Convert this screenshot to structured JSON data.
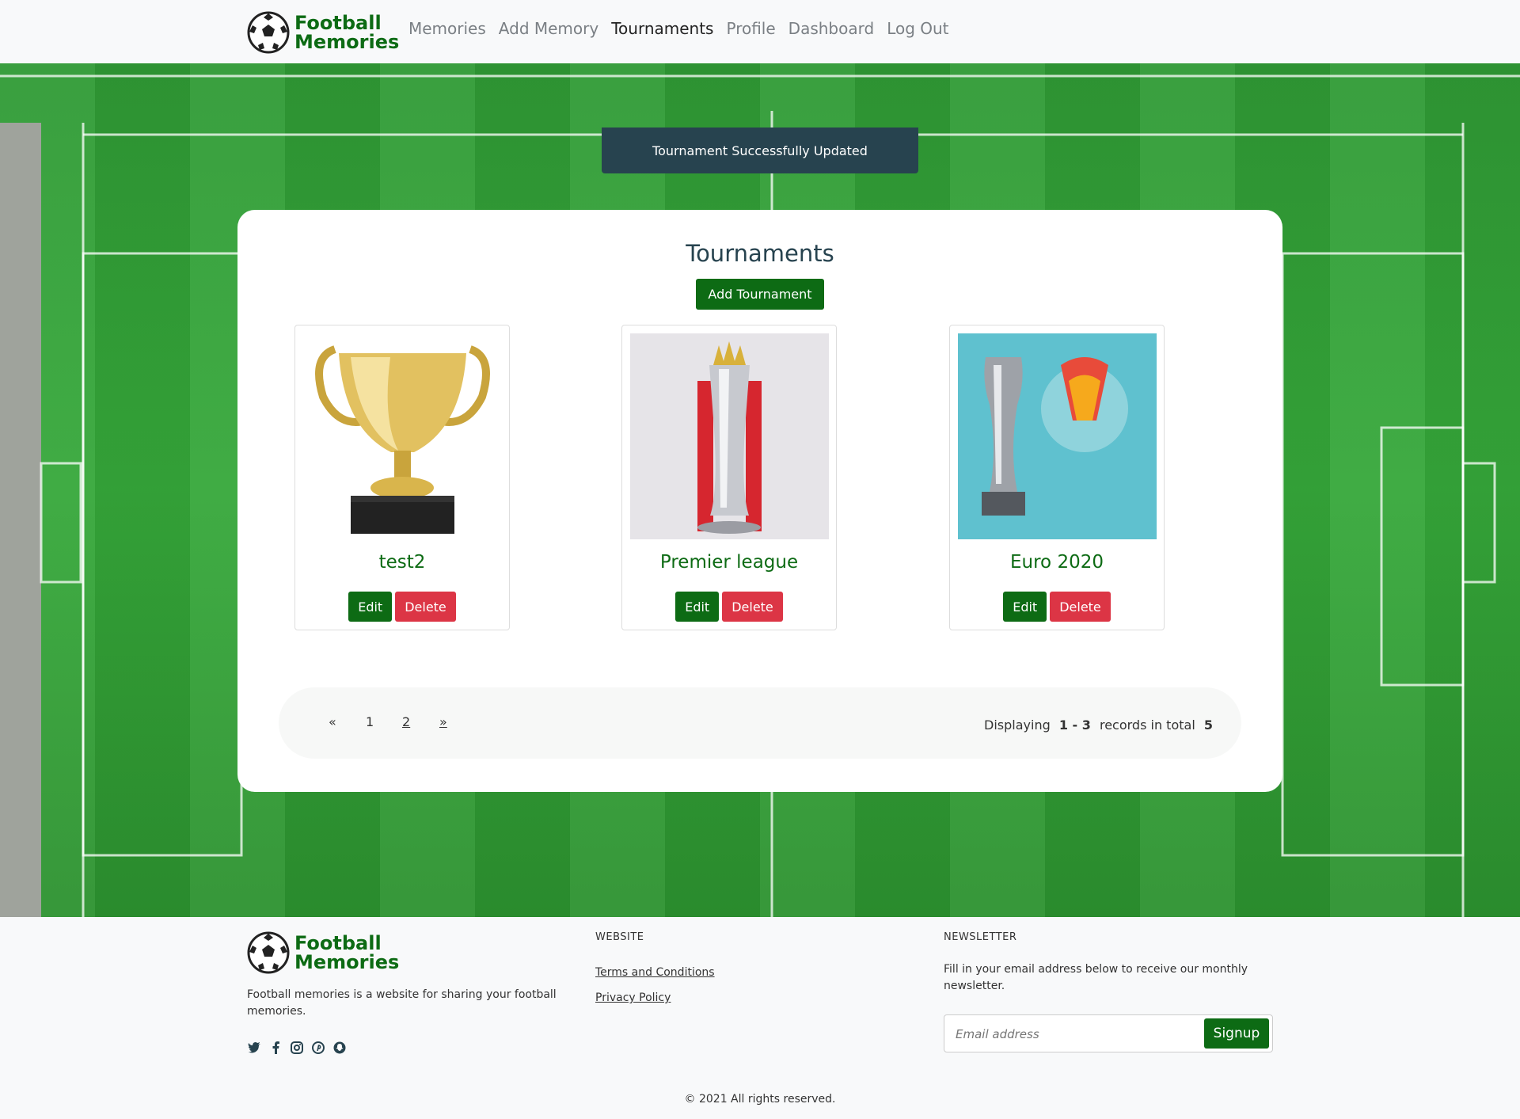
{
  "brand": {
    "line1": "Football",
    "line2": "Memories"
  },
  "nav": {
    "items": [
      {
        "label": "Memories"
      },
      {
        "label": "Add Memory"
      },
      {
        "label": "Tournaments"
      },
      {
        "label": "Profile"
      },
      {
        "label": "Dashboard"
      },
      {
        "label": "Log Out"
      }
    ],
    "active": "Tournaments"
  },
  "toast": {
    "message": "Tournament Successfully Updated"
  },
  "main": {
    "title": "Tournaments",
    "add_label": "Add Tournament",
    "cards": [
      {
        "name": "test2",
        "edit_label": "Edit",
        "delete_label": "Delete",
        "image": "gold-trophy-icon"
      },
      {
        "name": "Premier league",
        "edit_label": "Edit",
        "delete_label": "Delete",
        "image": "premier-league-trophy-icon"
      },
      {
        "name": "Euro 2020",
        "edit_label": "Edit",
        "delete_label": "Delete",
        "image": "euro-2020-trophy-icon"
      }
    ]
  },
  "pagination": {
    "prev": "«",
    "pages": [
      "1",
      "2"
    ],
    "next": "»",
    "current_page": 1,
    "info_prefix": "Displaying",
    "range": "1 - 3",
    "info_middle": "records in total",
    "total": "5"
  },
  "footer": {
    "description": "Football memories is a website for sharing your football memories.",
    "website_heading": "WEBSITE",
    "links": [
      "Terms and Conditions",
      "Privacy Policy"
    ],
    "newsletter_heading": "NEWSLETTER",
    "newsletter_text": "Fill in your email address below to receive our monthly newsletter.",
    "email_placeholder": "Email address",
    "signup_label": "Signup",
    "copyright": "© 2021 All rights reserved.",
    "socials": [
      "twitter-icon",
      "facebook-icon",
      "instagram-icon",
      "pinterest-icon",
      "snapchat-icon"
    ]
  },
  "colors": {
    "brand_green": "#0d6b14",
    "danger": "#dc3545",
    "toast_bg": "#27434f"
  }
}
